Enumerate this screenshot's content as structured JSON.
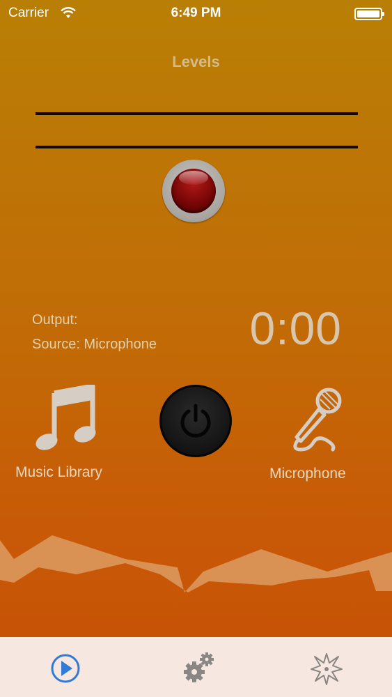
{
  "status_bar": {
    "carrier": "Carrier",
    "time": "6:49 PM",
    "battery_level": 1.0
  },
  "levels": {
    "title": "Levels"
  },
  "info": {
    "output": "Output:",
    "source": "Source: Microphone",
    "timer": "0:00"
  },
  "controls": {
    "music_library_label": "Music Library",
    "microphone_label": "Microphone",
    "music_icon": "music-note-icon",
    "power_icon": "power-icon",
    "mic_icon": "microphone-icon"
  },
  "tabbar": {
    "tabs": [
      {
        "icon": "play-icon",
        "active": true
      },
      {
        "icon": "gears-icon",
        "active": false
      },
      {
        "icon": "starburst-icon",
        "active": false
      }
    ]
  },
  "colors": {
    "accent": "#2f7bd6",
    "record": "#7a0606",
    "background_top": "#b97f05",
    "background_bottom": "#c65006"
  }
}
